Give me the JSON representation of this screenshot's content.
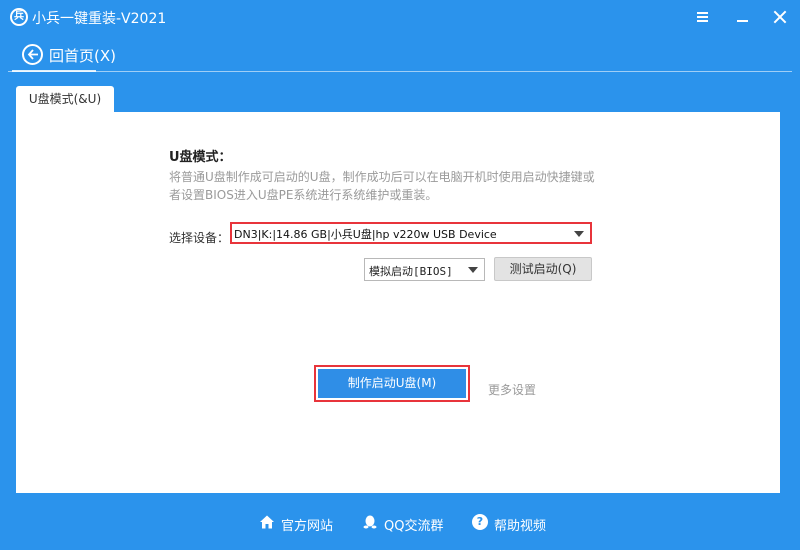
{
  "window": {
    "title": "小兵一键重装-V2021",
    "logo_glyph": "兵"
  },
  "nav": {
    "back_label": "回首页(X)"
  },
  "tabs": [
    {
      "label": "U盘模式(&U)"
    }
  ],
  "main": {
    "heading": "U盘模式：",
    "description": "将普通U盘制作成可启动的U盘，制作成功后可以在电脑开机时使用启动快捷键或者设置BIOS进入U盘PE系统进行系统维护或重装。",
    "device_label": "选择设备：",
    "device_value": "DN3|K:|14.86 GB|小兵U盘|hp v220w USB Device",
    "boot_mode_value": "模拟启动[BIOS]",
    "test_button": "测试启动(Q)",
    "make_button": "制作启动U盘(M)",
    "more_settings": "更多设置"
  },
  "footer": {
    "official_site": "官方网站",
    "qq_group": "QQ交流群",
    "help_video": "帮助视频"
  },
  "colors": {
    "accent": "#2b93ec",
    "button_blue": "#2f8ee7",
    "highlight_red": "#e8343b"
  },
  "icons": {
    "home": "home-icon",
    "qq": "qq-penguin-icon",
    "help": "help-icon",
    "back": "back-arrow-icon"
  }
}
